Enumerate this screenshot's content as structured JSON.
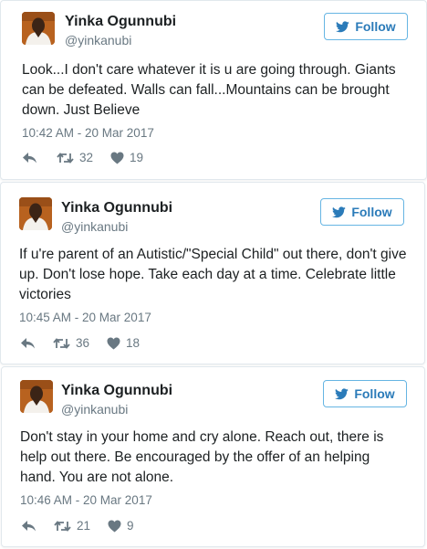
{
  "follow_label": "Follow",
  "icons": {
    "twitter": "twitter-bird-icon",
    "reply": "reply-arrow-icon",
    "retweet": "retweet-icon",
    "like": "heart-icon"
  },
  "colors": {
    "accent": "#2b7bb9",
    "muted": "#697882",
    "border": "#e1e8ed"
  },
  "tweets": [
    {
      "name": "Yinka Ogunnubi",
      "handle": "@yinkanubi",
      "text": "Look...I don't care whatever it is u are going through. Giants can be defeated. Walls can fall...Mountains can be brought down. Just Believe",
      "timestamp": "10:42 AM - 20 Mar 2017",
      "retweets": "32",
      "likes": "19"
    },
    {
      "name": "Yinka Ogunnubi",
      "handle": "@yinkanubi",
      "text": "If u're parent of an Autistic/\"Special Child\" out there, don't give up. Don't lose hope. Take each day at a time. Celebrate little victories",
      "timestamp": "10:45 AM - 20 Mar 2017",
      "retweets": "36",
      "likes": "18"
    },
    {
      "name": "Yinka Ogunnubi",
      "handle": "@yinkanubi",
      "text": "Don't stay in your home and cry alone. Reach out, there is help out there. Be encouraged by the offer of an helping hand. You are not alone.",
      "timestamp": "10:46 AM - 20 Mar 2017",
      "retweets": "21",
      "likes": "9"
    }
  ]
}
